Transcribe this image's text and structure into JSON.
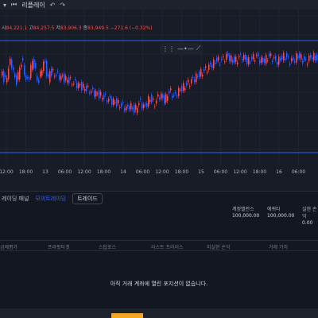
{
  "topbar": {
    "replay_label": "리플레이",
    "undo_icon": "undo-icon",
    "redo_icon": "redo-icon"
  },
  "ohlc": {
    "open_label": "시",
    "open": "84,221.1",
    "high_label": "고",
    "high": "84,257.5",
    "low_label": "저",
    "low": "83,906.3",
    "close_label": "종",
    "close": "83,949.5",
    "change": "−271.6 (−0.32%)"
  },
  "chart_data": {
    "type": "candlestick",
    "x_tick_labels": [
      "12:00",
      "18:00",
      "13",
      "06:00",
      "12:00",
      "18:00",
      "14",
      "06:00",
      "12:00",
      "18:00",
      "15",
      "06:00",
      "12:00",
      "18:00",
      "16",
      "06:00"
    ],
    "horizontal_lines": 2,
    "colors": {
      "up": "#ef5350",
      "down": "#2962ff",
      "line": "#2962ff"
    }
  },
  "panel": {
    "tabs": [
      "레이딩 패널",
      "모의트레이딩",
      "트레이드"
    ],
    "stats": [
      {
        "label": "계정밸런스",
        "value": "100,000.00"
      },
      {
        "label": "에퀴티",
        "value": "100,000.00"
      },
      {
        "label": "실현 손익",
        "value": "0.00"
      }
    ],
    "columns": [
      "금제평가",
      "프라핏타겟",
      "스탑로스",
      "라스트 프라이스",
      "미실현 손익",
      "거래 가치"
    ],
    "empty_message": "아직 거래 계좌에 열린 포지션이 없습니다."
  }
}
